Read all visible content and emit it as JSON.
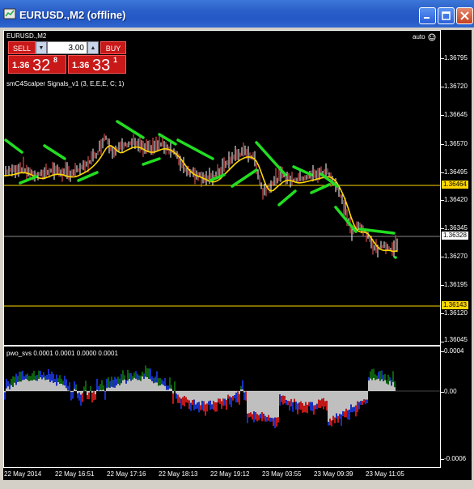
{
  "window": {
    "title": "EURUSD.,M2 (offline)",
    "minimize_icon": "minimize-icon",
    "maximize_icon": "maximize-icon",
    "close_icon": "close-icon"
  },
  "chart": {
    "symbol_label": "EURUSD.,M2",
    "auto_label": "auto",
    "indicator_label": "smC4Scalper Signals_v1 (3, E,E,E, C; 1)",
    "subwindow_label": "pwo_svs 0.0001 0.0001 0.0000 0.0001"
  },
  "trade_panel": {
    "sell_label": "SELL",
    "buy_label": "BUY",
    "lot_value": "3.00",
    "sell_small": "1.36",
    "sell_big": "32",
    "sell_sup": "8",
    "buy_small": "1.36",
    "buy_big": "33",
    "buy_sup": "1"
  },
  "price_scale": [
    "1.36795",
    "1.36720",
    "1.36645",
    "1.36570",
    "1.36495",
    "1.36420",
    "1.36345",
    "1.36270",
    "1.36195",
    "1.36120",
    "1.36045"
  ],
  "price_tags": {
    "upper_level": "1.36464",
    "bid": "1.36328",
    "lower_level": "1.36143"
  },
  "indicator_scale": [
    "0.0004",
    "0.00",
    "-0.0006"
  ],
  "time_axis": [
    "22 May 2014",
    "22 May 16:51",
    "22 May 17:16",
    "22 May 18:13",
    "22 May 19:12",
    "23 May 03:55",
    "23 May 09:39",
    "23 May 11:05"
  ],
  "colors": {
    "title_bar": "#2458c4",
    "level_line": "#ffd700",
    "signal": "#22dd22",
    "ma": "#ffd700",
    "bear_hist": "#ff2020",
    "bull_hist": "#2040ff",
    "green_hist": "#108010"
  }
}
